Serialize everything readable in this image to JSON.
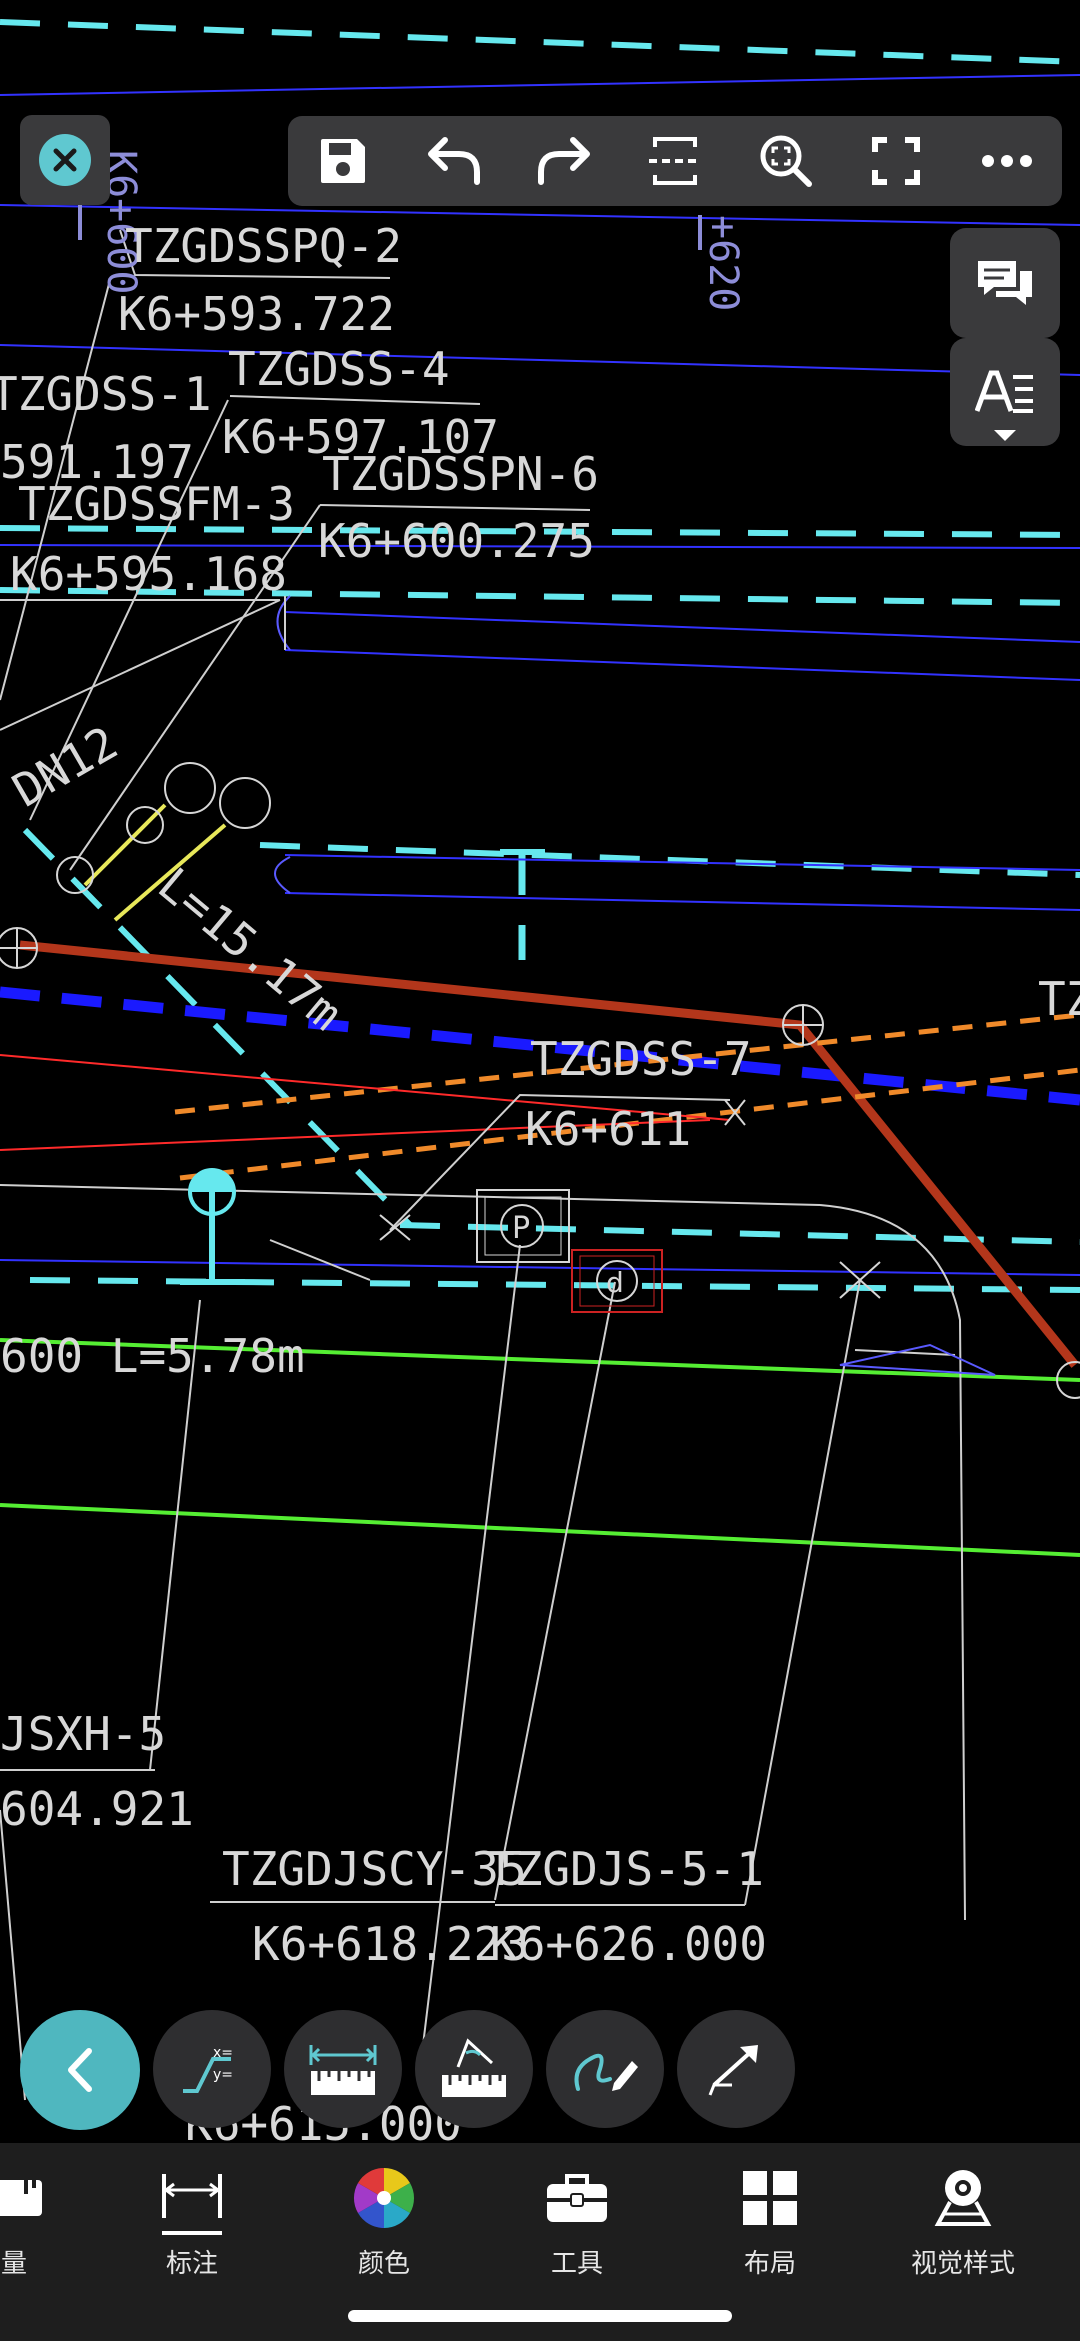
{
  "drawing": {
    "labels": {
      "l1": "TZGDSSPQ-2",
      "l2": "K6+593.722",
      "l3": "TZGDSS-4",
      "l4": "K6+597.107",
      "l5": "TZGDSS-1",
      "l6": "591.197",
      "l7": "TZGDSSPN-6",
      "l8": "TZGDSSFM-3",
      "l9": "K6+600.275",
      "l10": "K6+595.168",
      "l11": "DN12",
      "l12": "L=15.17m",
      "l13": "TZGDSS-7",
      "l14": "K6+611",
      "l15": "600  L=5.78m",
      "l16": "JSXH-5",
      "l17": "604.921",
      "l18": "TZGDJSCY-35",
      "l19": "TZGDJS-5-1",
      "l20": "K6+618.223",
      "l21": "K6+626.000",
      "l22": "K6+615.000",
      "l23": "K6+600",
      "l24": "+620",
      "l25": "TZ"
    }
  },
  "top_toolbar": {
    "close": "close-icon",
    "save": "save-icon",
    "undo": "undo-icon",
    "redo": "redo-icon",
    "section": "section-icon",
    "zoom": "zoom-icon",
    "fullscreen": "fullscreen-icon",
    "more": "more-icon"
  },
  "tabs": [
    {
      "label": "量",
      "icon": "ruler-icon"
    },
    {
      "label": "标注",
      "icon": "dimension-icon"
    },
    {
      "label": "颜色",
      "icon": "color-wheel-icon"
    },
    {
      "label": "工具",
      "icon": "toolbox-icon"
    },
    {
      "label": "布局",
      "icon": "layout-icon"
    },
    {
      "label": "视觉样式",
      "icon": "visual-style-icon"
    }
  ],
  "colors": {
    "accent": "#5fc8d0",
    "toolbar_bg": "#3a3a3c",
    "tabbar_bg": "#1e1e1e"
  }
}
